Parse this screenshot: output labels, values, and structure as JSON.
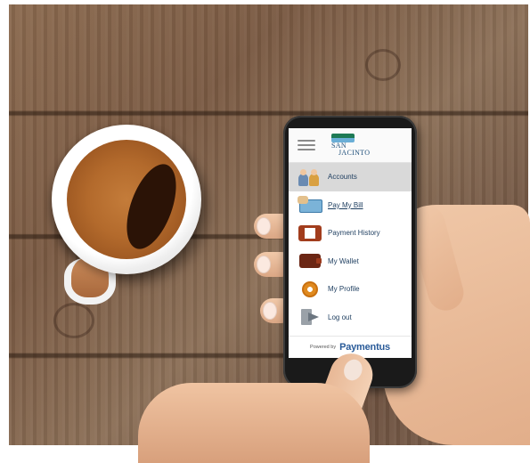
{
  "app": {
    "logo": {
      "line1": "SAN",
      "line2": "JACINTO"
    },
    "menu": [
      {
        "label": "Accounts",
        "icon": "accounts-icon",
        "active": true,
        "link": false
      },
      {
        "label": "Pay My Bill",
        "icon": "pay-bill-icon",
        "active": false,
        "link": true
      },
      {
        "label": "Payment History",
        "icon": "payment-history-icon",
        "active": false,
        "link": false
      },
      {
        "label": "My Wallet",
        "icon": "wallet-icon",
        "active": false,
        "link": false
      },
      {
        "label": "My Profile",
        "icon": "profile-gear-icon",
        "active": false,
        "link": false
      },
      {
        "label": "Log out",
        "icon": "logout-icon",
        "active": false,
        "link": false
      }
    ],
    "footer": {
      "powered_by": "Powered by",
      "brand": "Paymentus"
    }
  },
  "colors": {
    "brand_blue": "#2a5b99",
    "menu_text": "#1d3d5f",
    "active_row": "#d9d9d9"
  }
}
